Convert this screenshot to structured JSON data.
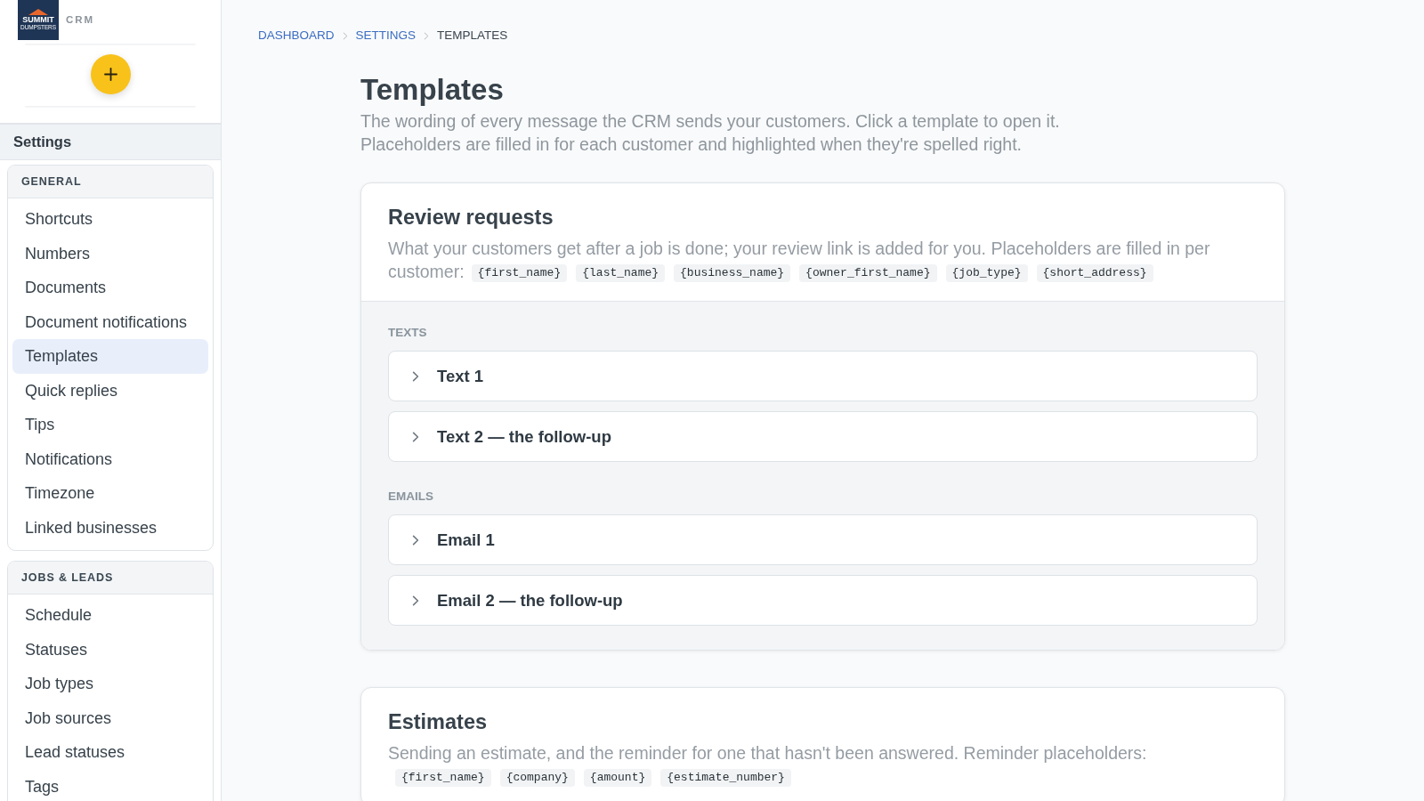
{
  "sidebar": {
    "logo": {
      "line_1": "SUMMIT",
      "line_2": "DUMPSTERS"
    },
    "app_label": "CRM",
    "section_title": "Settings",
    "groups": [
      {
        "title": "GENERAL",
        "items": [
          {
            "label": "Shortcuts",
            "selected": false
          },
          {
            "label": "Numbers",
            "selected": false
          },
          {
            "label": "Documents",
            "selected": false
          },
          {
            "label": "Document notifications",
            "selected": false
          },
          {
            "label": "Templates",
            "selected": true
          },
          {
            "label": "Quick replies",
            "selected": false
          },
          {
            "label": "Tips",
            "selected": false
          },
          {
            "label": "Notifications",
            "selected": false
          },
          {
            "label": "Timezone",
            "selected": false
          },
          {
            "label": "Linked businesses",
            "selected": false
          }
        ]
      },
      {
        "title": "JOBS & LEADS",
        "items": [
          {
            "label": "Schedule",
            "selected": false
          },
          {
            "label": "Statuses",
            "selected": false
          },
          {
            "label": "Job types",
            "selected": false
          },
          {
            "label": "Job sources",
            "selected": false
          },
          {
            "label": "Lead statuses",
            "selected": false
          },
          {
            "label": "Tags",
            "selected": false
          }
        ]
      }
    ]
  },
  "breadcrumb": [
    {
      "label": "DASHBOARD",
      "kind": "link"
    },
    {
      "label": "SETTINGS",
      "kind": "link"
    },
    {
      "label": "TEMPLATES",
      "kind": "current"
    }
  ],
  "page": {
    "title": "Templates",
    "description": [
      "The wording of every message the CRM sends your customers. Click a template to open it.",
      "Placeholders are filled in for each customer and highlighted when they're spelled right."
    ]
  },
  "sections": [
    {
      "title": "Review requests",
      "description": "What your customers get after a job is done; your review link is added for you. Placeholders are filled in per customer:",
      "placeholders": [
        "{first_name}",
        "{last_name}",
        "{business_name}",
        "{owner_first_name}",
        "{job_type}",
        "{short_address}"
      ],
      "groups": [
        {
          "label": "TEXTS",
          "templates": [
            {
              "title": "Text 1",
              "expanded": false
            },
            {
              "title": "Text 2 — the follow-up",
              "expanded": false
            }
          ]
        },
        {
          "label": "EMAILS",
          "templates": [
            {
              "title": "Email 1",
              "expanded": false
            },
            {
              "title": "Email 2 — the follow-up",
              "expanded": false
            }
          ]
        }
      ]
    },
    {
      "title": "Estimates",
      "description": "Sending an estimate, and the reminder for one that hasn't been answered. Reminder placeholders:",
      "placeholders": [
        "{first_name}",
        "{company}",
        "{amount}",
        "{estimate_number}"
      ]
    }
  ]
}
